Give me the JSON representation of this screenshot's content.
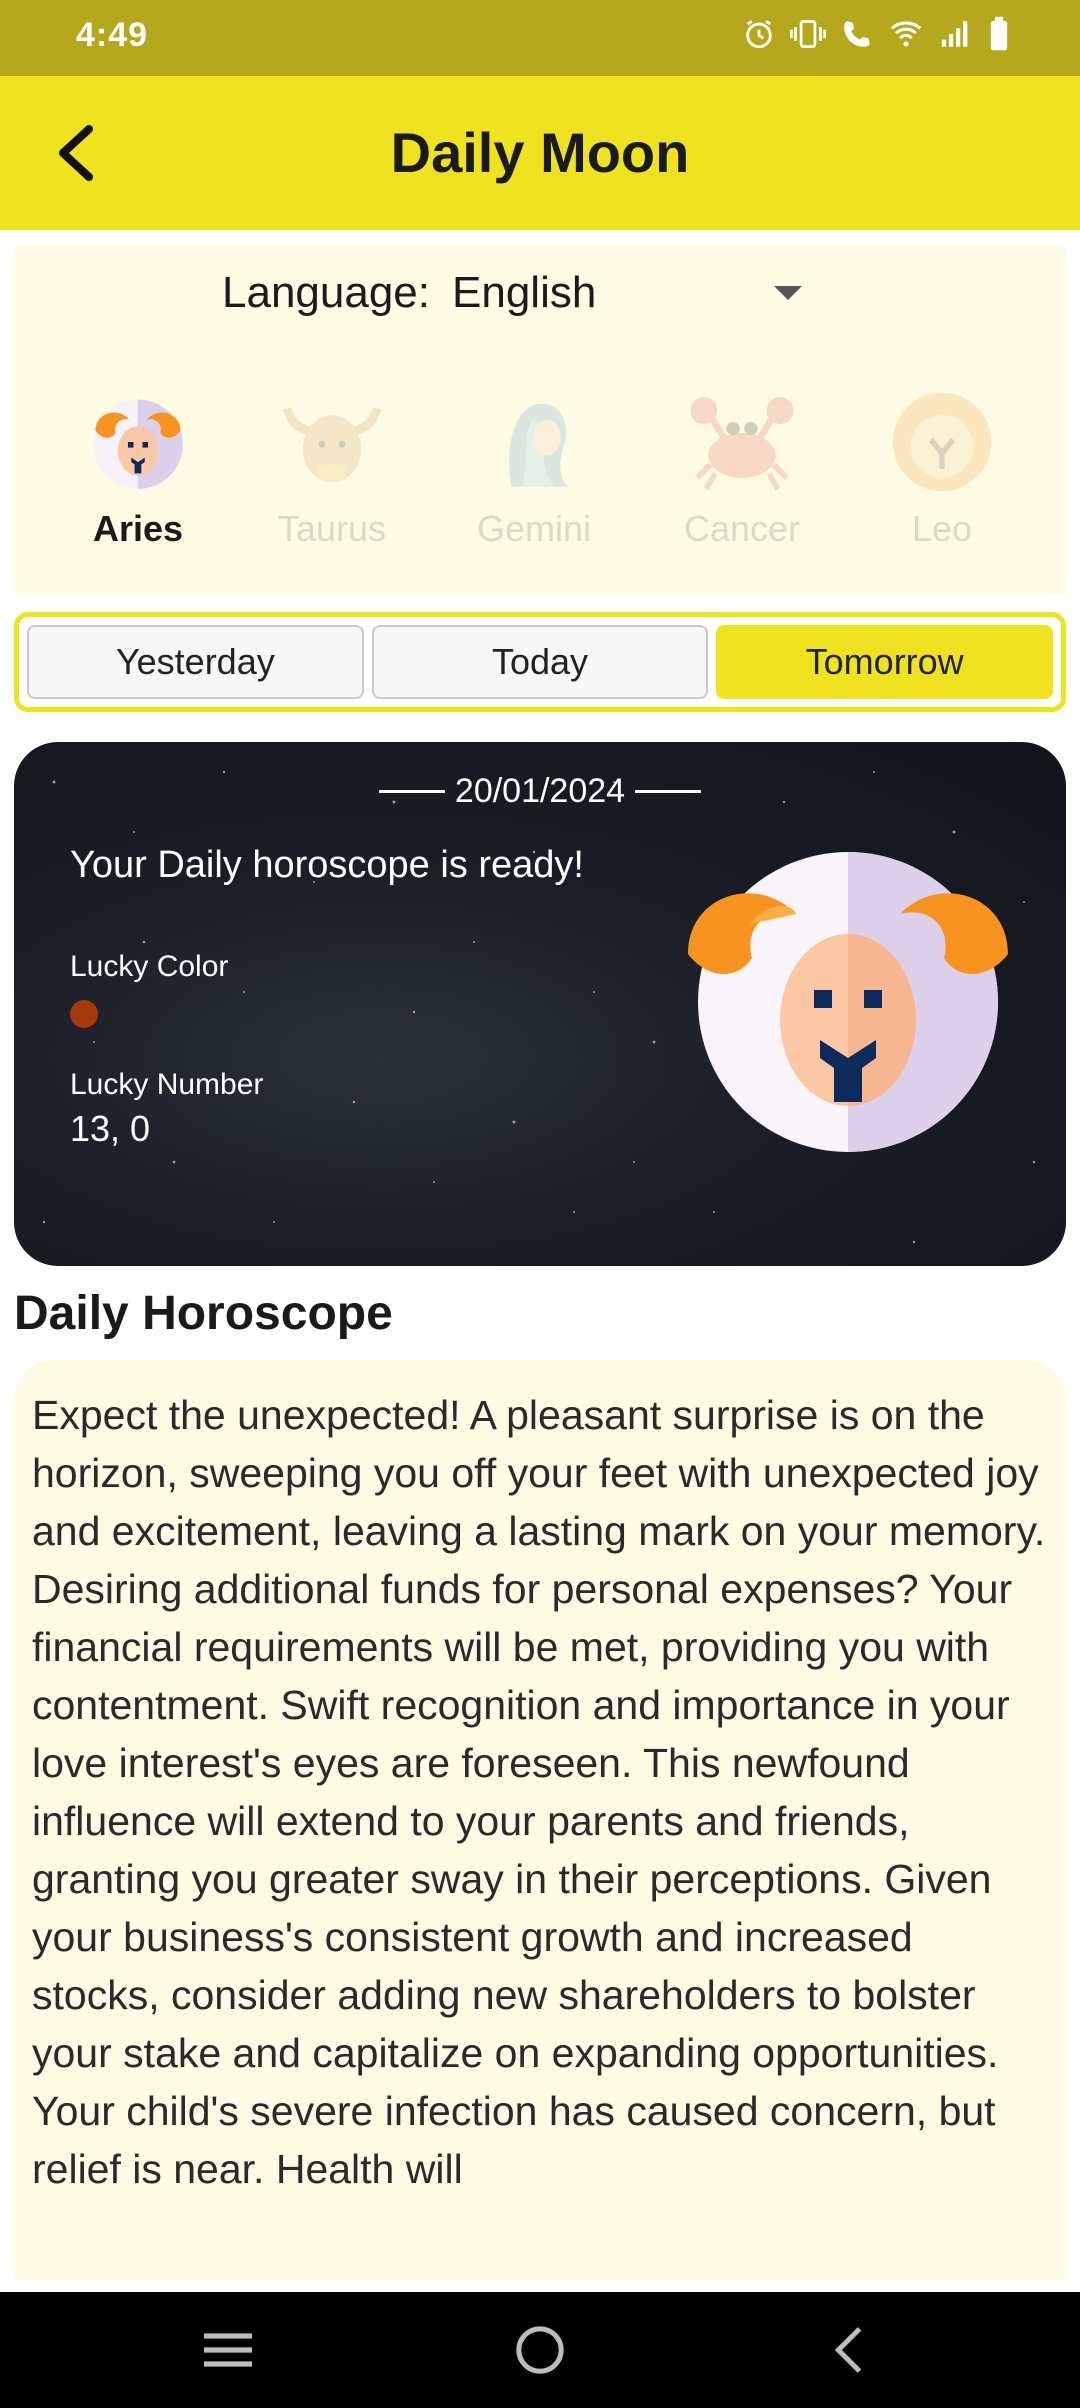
{
  "status_bar": {
    "time": "4:49",
    "icons": [
      "alarm-icon",
      "vibrate-icon",
      "wifi-calling-icon",
      "wifi-icon",
      "signal-icon",
      "battery-icon"
    ]
  },
  "app_bar": {
    "title": "Daily Moon",
    "back_icon": "chevron-left-icon"
  },
  "language": {
    "label": "Language:",
    "value": "English"
  },
  "signs": [
    {
      "label": "Aries",
      "selected": true
    },
    {
      "label": "Taurus",
      "selected": false
    },
    {
      "label": "Gemini",
      "selected": false
    },
    {
      "label": "Cancer",
      "selected": false
    },
    {
      "label": "Leo",
      "selected": false
    }
  ],
  "day_tabs": [
    {
      "label": "Yesterday",
      "selected": false
    },
    {
      "label": "Today",
      "selected": false
    },
    {
      "label": "Tomorrow",
      "selected": true
    }
  ],
  "card": {
    "date": "20/01/2024",
    "ready_text": "Your Daily horoscope is ready!",
    "lucky_color_label": "Lucky Color",
    "lucky_color": "#a6380c",
    "lucky_number_label": "Lucky Number",
    "lucky_number": "13, 0"
  },
  "horoscope": {
    "title": "Daily Horoscope",
    "text": "Expect the unexpected! A pleasant surprise is on the horizon, sweeping you off your feet with unexpected joy and excitement, leaving a lasting mark on your memory. Desiring additional funds for personal expenses? Your financial requirements will be met, providing you with contentment. Swift recognition and importance in your love interest's eyes are foreseen. This newfound influence will extend to your parents and friends, granting you greater sway in their perceptions. Given your business's consistent growth and increased stocks, consider adding new shareholders to bolster your stake and capitalize on expanding opportunities. Your child's severe infection has caused concern, but relief is near. Health will"
  },
  "colors": {
    "status_bar": "#b5a81d",
    "accent_yellow": "#efe31f",
    "panel_cream": "#fdfbe4",
    "card_dark": "#1a1d26"
  },
  "nav_bar": {
    "icons": [
      "menu-icon",
      "home-icon",
      "back-icon"
    ]
  }
}
